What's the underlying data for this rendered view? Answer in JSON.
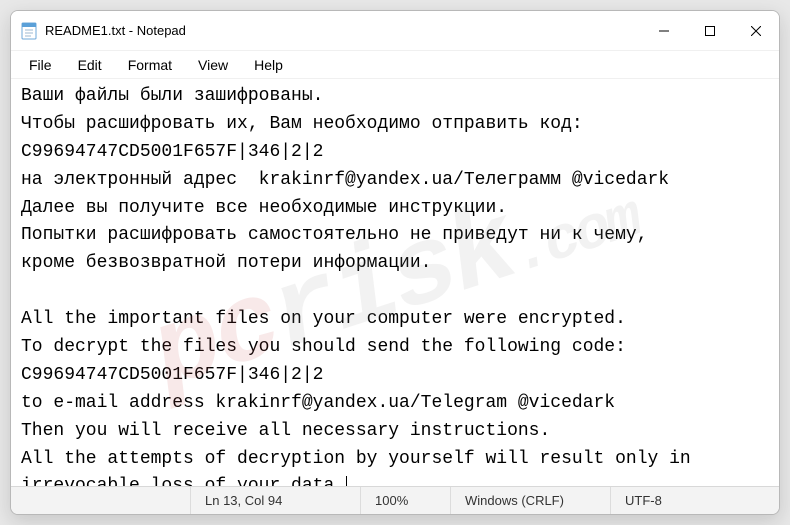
{
  "window": {
    "title": "README1.txt - Notepad",
    "icon": "notepad-icon"
  },
  "menu": {
    "items": [
      "File",
      "Edit",
      "Format",
      "View",
      "Help"
    ]
  },
  "document": {
    "text": "Ваши файлы были зашифрованы.\nЧтобы расшифровать их, Вам необходимо отправить код:\nC99694747CD5001F657F|346|2|2\nна электронный адрес  krakinrf@yandex.ua/Телеграмм @vicedark\nДалее вы получите все необходимые инструкции.\nПопытки расшифровать самостоятельно не приведут ни к чему,\nкроме безвозвратной потери информации.\n\nAll the important files on your computer were encrypted.\nTo decrypt the files you should send the following code:\nC99694747CD5001F657F|346|2|2\nto e-mail address krakinrf@yandex.ua/Telegram @vicedark\nThen you will receive all necessary instructions.\nAll the attempts of decryption by yourself will result only in irrevocable loss of your data."
  },
  "status": {
    "lncol": "Ln 13, Col 94",
    "zoom": "100%",
    "eol": "Windows (CRLF)",
    "encoding": "UTF-8"
  }
}
